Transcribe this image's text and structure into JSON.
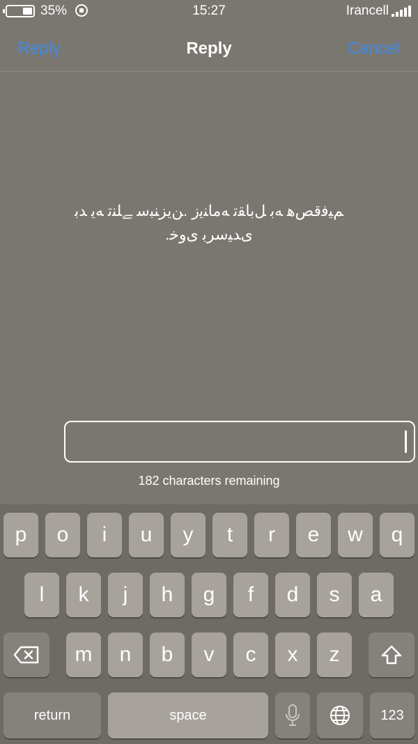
{
  "status_bar": {
    "battery_percent": "35%",
    "time": "15:27",
    "carrier": "Irancell"
  },
  "navbar": {
    "left_button": "Reply",
    "title": "Reply",
    "right_button": "Cancel"
  },
  "message": {
    "line1": "ﻢﻴﻓﻗﺺﻫ ﻪﺑ ﻞﺑﺎﻘﺗ ﻪﻣﺎﻨﯾﺯ .ﻦﯾﺰﻨﺒﺳ ﮯﻠﻨﺗ ﻪﯾ ﺪﺑ",
    "line2": ".ﯼﺪﻴﺳﺮﺑ ﯼﻭﺧ"
  },
  "reply_input": {
    "value": "",
    "remaining": "182 characters remaining"
  },
  "keyboard": {
    "row1": [
      "p",
      "o",
      "i",
      "u",
      "y",
      "t",
      "r",
      "e",
      "w",
      "q"
    ],
    "row2": [
      "l",
      "k",
      "j",
      "h",
      "g",
      "f",
      "d",
      "s",
      "a"
    ],
    "row3": [
      "m",
      "n",
      "b",
      "v",
      "c",
      "x",
      "z"
    ],
    "return_label": "return",
    "space_label": "space",
    "numbers_label": "123"
  },
  "colors": {
    "background": "#7a7771",
    "accent": "#3d8bea",
    "key": "#a7a39c",
    "key_dark": "#85827c"
  }
}
